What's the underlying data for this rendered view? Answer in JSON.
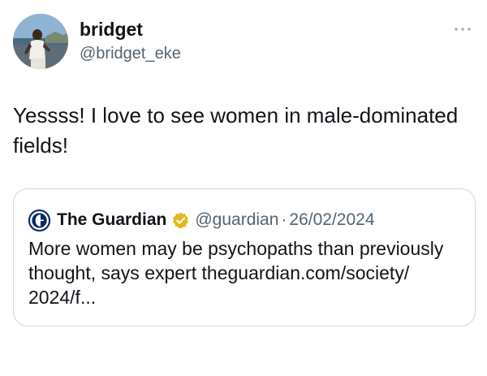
{
  "author": {
    "name": "bridget",
    "handle": "@bridget_eke",
    "avatar_icon": "user-avatar-photo"
  },
  "more_icon": "more-horizontal-icon",
  "tweet": {
    "text": "Yessss! I love to see women in male-dominated fields!"
  },
  "quoted": {
    "logo_icon": "guardian-logo-icon",
    "name": "The Guardian",
    "badge_icon": "verified-gold-badge-icon",
    "handle": "@guardian",
    "separator": "·",
    "date": "26/02/2024",
    "text": "More women may be psychopaths than previously thought, says expert theguardian.com/society/ 2024/f..."
  },
  "colors": {
    "text_primary": "#0f1419",
    "text_secondary": "#536471",
    "border": "#cfd9de",
    "verified_gold": "#e2b719"
  }
}
